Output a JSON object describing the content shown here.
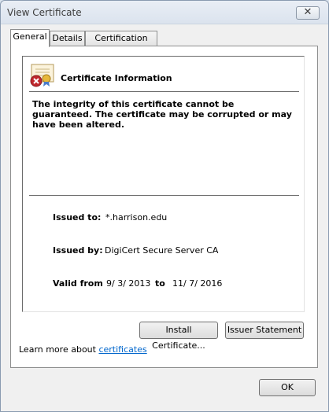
{
  "window": {
    "title": "View Certificate",
    "close_glyph": "✕"
  },
  "tabs": [
    {
      "label": "General",
      "active": true
    },
    {
      "label": "Details",
      "active": false
    },
    {
      "label": "Certification Path",
      "active": false
    }
  ],
  "certificate": {
    "icon": "certificate-error-icon",
    "heading": "Certificate Information",
    "warning": "The integrity of this certificate cannot be guaranteed. The certificate may be corrupted or may have been altered.",
    "issued_to_label": "Issued to:",
    "issued_to": "*.harrison.edu",
    "issued_by_label": "Issued by:",
    "issued_by": "DigiCert Secure Server CA",
    "valid_from_label": "Valid from",
    "valid_from": "9/ 3/ 2013",
    "to_label": "to",
    "valid_to": "11/ 7/ 2016"
  },
  "buttons": {
    "install": "Install Certificate...",
    "issuer_statement": "Issuer Statement",
    "ok": "OK"
  },
  "learn_more": {
    "prefix": "Learn more about",
    "link": "certificates"
  },
  "colors": {
    "link": "#0066cc",
    "error_red": "#c0282d"
  }
}
